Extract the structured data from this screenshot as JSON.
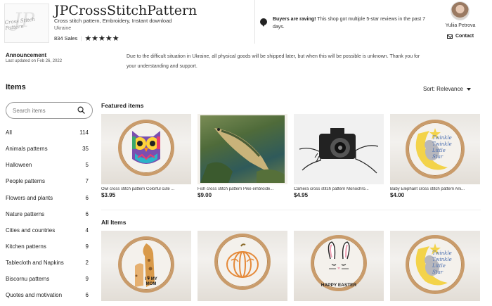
{
  "shop": {
    "name": "JPCrossStitchPattern",
    "description": "Cross stitch pattern, Embroidery, Instant download",
    "location": "Ukraine",
    "sales": "834 Sales",
    "stars": "★★★★★",
    "logo_text": "Cross Stitch Pattern"
  },
  "review": {
    "bold": "Buyers are raving!",
    "text": " This shop got multiple 5-star reviews in the past 7 days."
  },
  "owner": {
    "name": "Yuliia Petrova",
    "contact_label": "Contact"
  },
  "announcement": {
    "title": "Announcement",
    "updated": "Last updated on Feb 26, 2022",
    "body": "Due to the difficult situation in Ukraine, all physical goods will be shipped later, but when this will be possible is unknown. Thank you for your understanding and support."
  },
  "items_title": "Items",
  "sort_label": "Sort: Relevance",
  "search": {
    "placeholder": "Search items",
    "value": ""
  },
  "sidebar": [
    {
      "label": "All",
      "count": "114"
    },
    {
      "label": "Animals patterns",
      "count": "35"
    },
    {
      "label": "Halloween",
      "count": "5"
    },
    {
      "label": "People patterns",
      "count": "7"
    },
    {
      "label": "Flowers and plants",
      "count": "6"
    },
    {
      "label": "Nature patterns",
      "count": "6"
    },
    {
      "label": "Cities and countries",
      "count": "4"
    },
    {
      "label": "Kitchen patterns",
      "count": "9"
    },
    {
      "label": "Tablecloth and Napkins",
      "count": "2"
    },
    {
      "label": "Biscornu patterns",
      "count": "9"
    },
    {
      "label": "Quotes and motivation",
      "count": "6"
    }
  ],
  "featured_title": "Featured items",
  "featured": [
    {
      "caption": "Owl cross stitch pattern Colorful cute ...",
      "price": "$3.95"
    },
    {
      "caption": "Fish cross stitch pattern Pike embroide...",
      "price": "$9.00"
    },
    {
      "caption": "Camera cross stitch pattern Monochro...",
      "price": "$4.95"
    },
    {
      "caption": "Baby Elephant cross stitch pattern Ani...",
      "price": "$4.00"
    }
  ],
  "all_items_title": "All Items",
  "art_text": {
    "elephant": "Twinkle Twinkle Little Star",
    "giraffe": "I ♥ MY MOM",
    "easter": "HAPPY EASTER"
  },
  "colors": {
    "hoop": "#c99b6a",
    "accent": "#222222"
  }
}
